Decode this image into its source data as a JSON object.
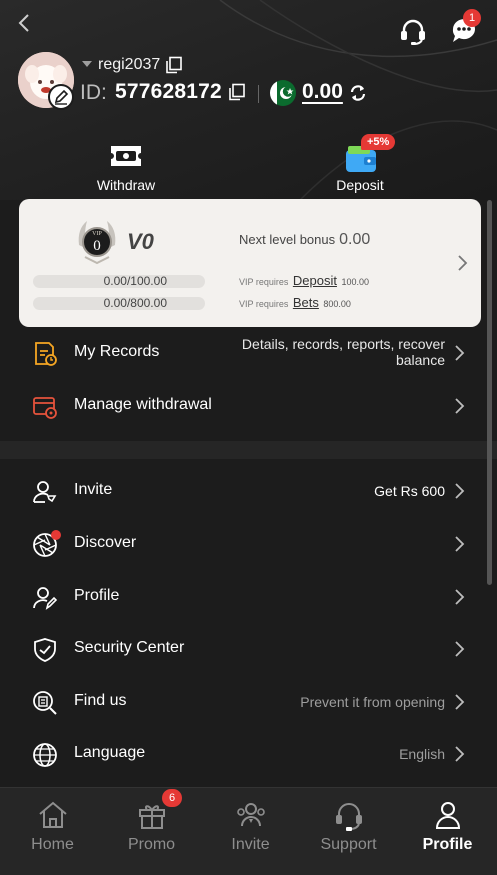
{
  "header": {
    "back_icon": "chevron-left-icon",
    "support_icon": "headset-icon",
    "messages_icon": "chat-bubble-icon",
    "messages_badge": "1"
  },
  "profile": {
    "username": "regi2037",
    "id_label": "ID:",
    "id_value": "577628172",
    "balance": "0.00",
    "currency_flag": "pakistan-flag-icon"
  },
  "actions": {
    "withdraw_label": "Withdraw",
    "deposit_label": "Deposit",
    "deposit_badge": "+5%"
  },
  "vip": {
    "level": "V0",
    "emblem_text": "VIP",
    "emblem_number": "0",
    "next_bonus_label": "Next level bonus",
    "next_bonus_value": "0.00",
    "deposit_progress": "0.00/100.00",
    "deposit_progress_fraction": 0,
    "bets_progress": "0.00/800.00",
    "bets_progress_fraction": 0,
    "req_prefix": "VIP requires",
    "deposit_link": "Deposit",
    "deposit_amount": "100.00",
    "bets_link": "Bets",
    "bets_amount": "800.00"
  },
  "menu_top": [
    {
      "label": "My Records",
      "right_line1": "Details, records, reports, recover",
      "right_line2": "balance",
      "icon": "records-icon"
    },
    {
      "label": "Manage withdrawal",
      "right": "",
      "icon": "withdrawal-settings-icon"
    }
  ],
  "menu_main": [
    {
      "label": "Invite",
      "right": "Get Rs 600",
      "icon": "invite-user-icon"
    },
    {
      "label": "Discover",
      "right": "",
      "icon": "aperture-icon"
    },
    {
      "label": "Profile",
      "right": "",
      "icon": "user-edit-icon"
    },
    {
      "label": "Security Center",
      "right": "",
      "icon": "shield-check-icon"
    },
    {
      "label": "Find us",
      "right": "Prevent it from opening",
      "icon": "search-document-icon"
    },
    {
      "label": "Language",
      "right": "English",
      "icon": "globe-icon"
    }
  ],
  "bottom_nav": [
    {
      "label": "Home",
      "icon": "home-icon"
    },
    {
      "label": "Promo",
      "icon": "gift-icon",
      "badge": "6"
    },
    {
      "label": "Invite",
      "icon": "team-icon"
    },
    {
      "label": "Support",
      "icon": "headset-icon"
    },
    {
      "label": "Profile",
      "icon": "user-icon",
      "active": true
    }
  ],
  "colors": {
    "background": "#1c1c1c",
    "vip_card": "#f3f1ee",
    "badge_red": "#e53935",
    "nav_bg": "#262626"
  }
}
